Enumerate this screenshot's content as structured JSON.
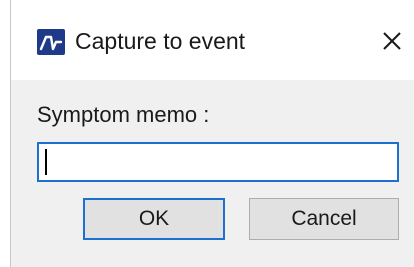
{
  "window": {
    "title": "Capture to event",
    "icon": "waveform-app-icon",
    "close_icon": "close-icon"
  },
  "form": {
    "memo_label": "Symptom memo :",
    "memo_value": "",
    "memo_placeholder": ""
  },
  "buttons": {
    "ok_label": "OK",
    "cancel_label": "Cancel"
  },
  "colors": {
    "accent": "#1d6fd0",
    "icon_background": "#1f3a8a",
    "dialog_background": "#f0f0f0",
    "titlebar_background": "#ffffff"
  }
}
